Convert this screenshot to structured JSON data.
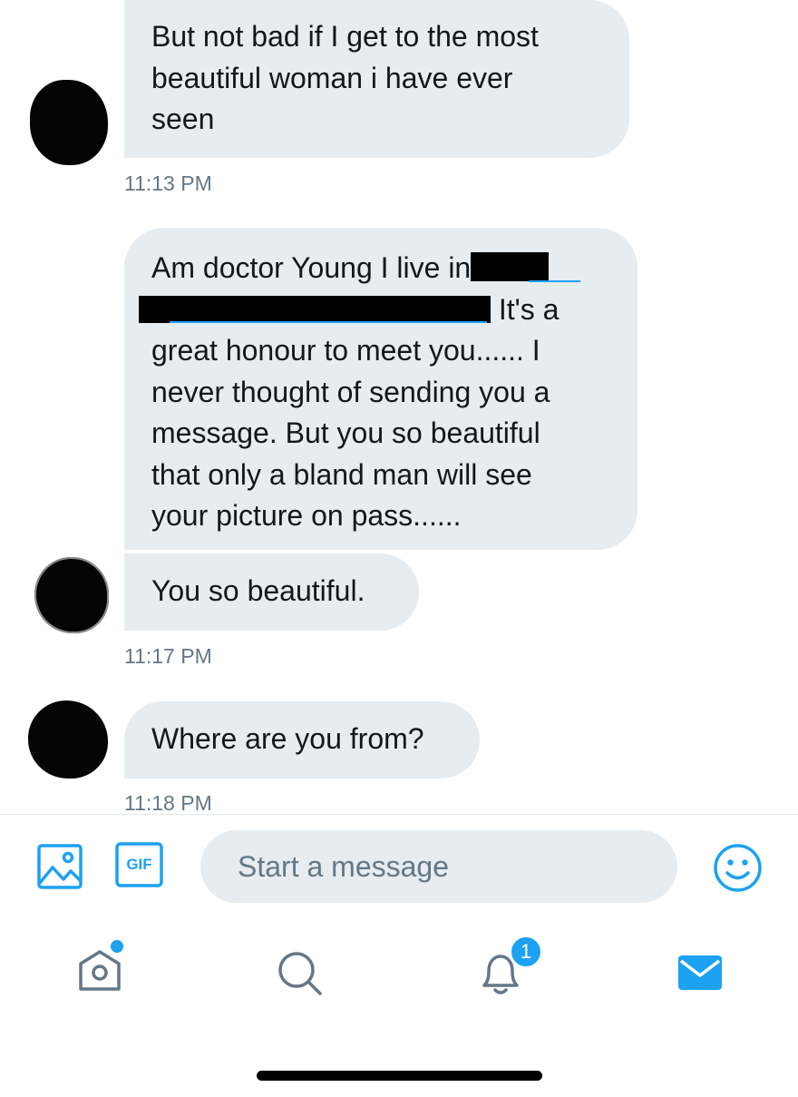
{
  "messages": [
    {
      "lines": [
        "But not bad if I get to the most",
        "beautiful woman i have ever",
        "seen"
      ],
      "timestamp": "11:13 PM"
    },
    {
      "line1": "Am doctor Young I live in",
      "line2_tail": " It's a",
      "lines_rest": [
        "great honour to meet you...... I",
        "never thought of sending you a",
        "message. But you so beautiful",
        "that only a bland man will see",
        "your picture on pass......"
      ]
    },
    {
      "text": "You so beautiful.",
      "timestamp": "11:17 PM"
    },
    {
      "text": "Where are you from?",
      "timestamp": "11:18 PM"
    }
  ],
  "composer": {
    "placeholder": "Start a message",
    "gif_label": "GIF"
  },
  "tabbar": {
    "notifications_badge": "1"
  },
  "colors": {
    "accent": "#1da1f2",
    "bubble": "#e6ecf0",
    "timestamp": "#657786",
    "icon_gray": "#657786"
  },
  "icons": [
    "image-icon",
    "gif-icon",
    "emoji-icon",
    "home-icon",
    "search-icon",
    "notifications-icon",
    "messages-icon"
  ]
}
